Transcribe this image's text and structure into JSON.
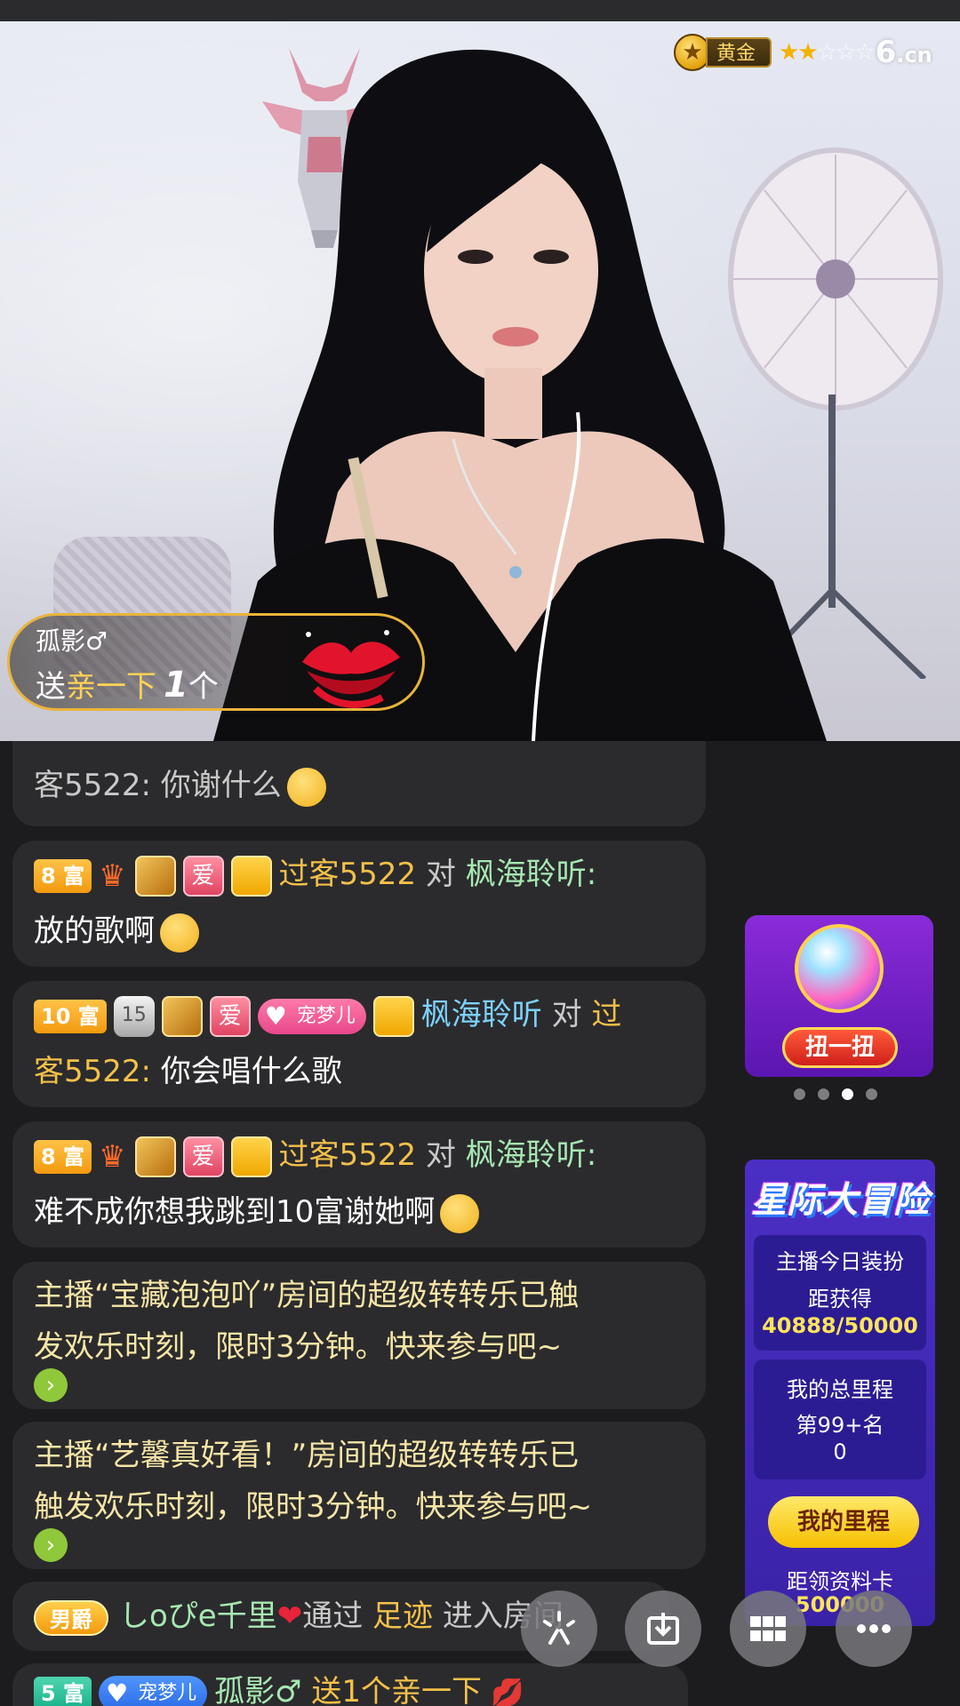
{
  "header": {
    "level_label": "黄金",
    "brand": "6",
    "brand_suffix": ".cn",
    "stars_on": "★★",
    "stars_off": "☆☆☆"
  },
  "gift_banner": {
    "user": "孤影♂",
    "verb": "送",
    "gift_name": "亲一下",
    "count": "1",
    "unit": "个"
  },
  "chat": {
    "msg0": {
      "text": "客5522: 你谢什么"
    },
    "msg1": {
      "level": "8 富",
      "love": "爱",
      "from": "过客5522",
      "to_word": "对",
      "to": "枫海聆听:",
      "text": "放的歌啊"
    },
    "msg2": {
      "level": "10 富",
      "guard_level": "15",
      "love": "爱",
      "pet": "宠梦儿",
      "from": "枫海聆听",
      "to_word": "对",
      "to_part1": "过",
      "to_part2": "客5522:",
      "text": "你会唱什么歌"
    },
    "msg3": {
      "level": "8 富",
      "love": "爱",
      "from": "过客5522",
      "to_word": "对",
      "to": "枫海聆听:",
      "text": "难不成你想我跳到10富谢她啊"
    },
    "sys1": {
      "line1": "主播“宝藏泡泡吖”房间的超级转转乐已触",
      "line2": "发欢乐时刻，限时3分钟。快来参与吧~",
      "go": "›"
    },
    "sys2": {
      "line1": "主播“艺馨真好看！”房间的超级转转乐已",
      "line2": "触发欢乐时刻，限时3分钟。快来参与吧~",
      "go": "›"
    },
    "enter": {
      "badge": "男爵",
      "user": "しoぴe千里",
      "heart": "❤",
      "via": "通过",
      "method": "足迹",
      "action": "进入房间"
    },
    "gift": {
      "level": "5 富",
      "pet": "宠梦儿",
      "user": "孤影♂",
      "text": "送1个亲一下"
    }
  },
  "gacha": {
    "button": "扭一扭"
  },
  "adventure": {
    "title": "星际大冒险",
    "card1_line1": "主播今日装扮",
    "card1_line2": "距获得",
    "card1_progress": "40888/50000",
    "card2_line1": "我的总里程",
    "card2_line2": "第99+名",
    "card2_value": "0",
    "button": "我的里程",
    "footer_line1": "距领资料卡",
    "footer_value": "500000"
  },
  "colors": {
    "accent_gold": "#f3c04a",
    "level_orange": "#f39a0e",
    "level_green": "#17b08a",
    "adventure_purple": "#3a22a8"
  },
  "icons": [
    "star-icon",
    "crown-icon",
    "gold-bar-icon",
    "user-icon",
    "guard-shield-icon",
    "heart-icon",
    "laugh-emoji-icon",
    "lips-icon",
    "sparkle-icon",
    "download-icon",
    "grid-icon",
    "more-icon"
  ]
}
